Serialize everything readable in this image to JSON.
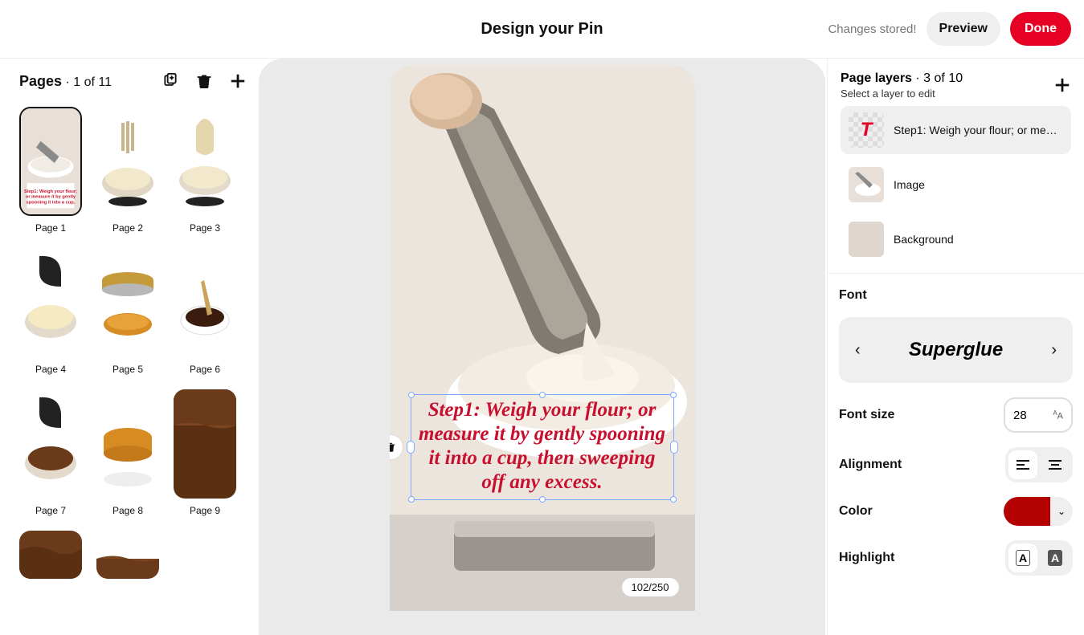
{
  "header": {
    "title": "Design your Pin",
    "status": "Changes stored!",
    "preview": "Preview",
    "done": "Done"
  },
  "pages": {
    "title": "Pages",
    "count": "· 1 of 11",
    "items": [
      {
        "label": "Page 1"
      },
      {
        "label": "Page 2"
      },
      {
        "label": "Page 3"
      },
      {
        "label": "Page 4"
      },
      {
        "label": "Page 5"
      },
      {
        "label": "Page 6"
      },
      {
        "label": "Page 7"
      },
      {
        "label": "Page 8"
      },
      {
        "label": "Page 9"
      },
      {
        "label": ""
      },
      {
        "label": ""
      }
    ]
  },
  "canvas": {
    "text": "Step1: Weigh your flour; or measure it by gently spooning it into a cup, then sweeping off any excess.",
    "char_counter": "102/250"
  },
  "layers": {
    "title": "Page layers",
    "count": "· 3 of 10",
    "subtitle": "Select a layer to edit",
    "items": [
      {
        "name": "Step1: Weigh your flour; or measu...",
        "type": "text",
        "glyph": "T"
      },
      {
        "name": "Image",
        "type": "image"
      },
      {
        "name": "Background",
        "type": "bg",
        "color": "#ded6cf"
      }
    ]
  },
  "font": {
    "label": "Font",
    "name": "Superglue",
    "size_label": "Font size",
    "size": "28",
    "align_label": "Alignment",
    "color_label": "Color",
    "color": "#b30000",
    "highlight_label": "Highlight",
    "highlight_glyph": "A"
  },
  "icons": {
    "chev_left": "‹",
    "chev_right": "›",
    "aa": "ᴬA",
    "caret": "⌄"
  }
}
